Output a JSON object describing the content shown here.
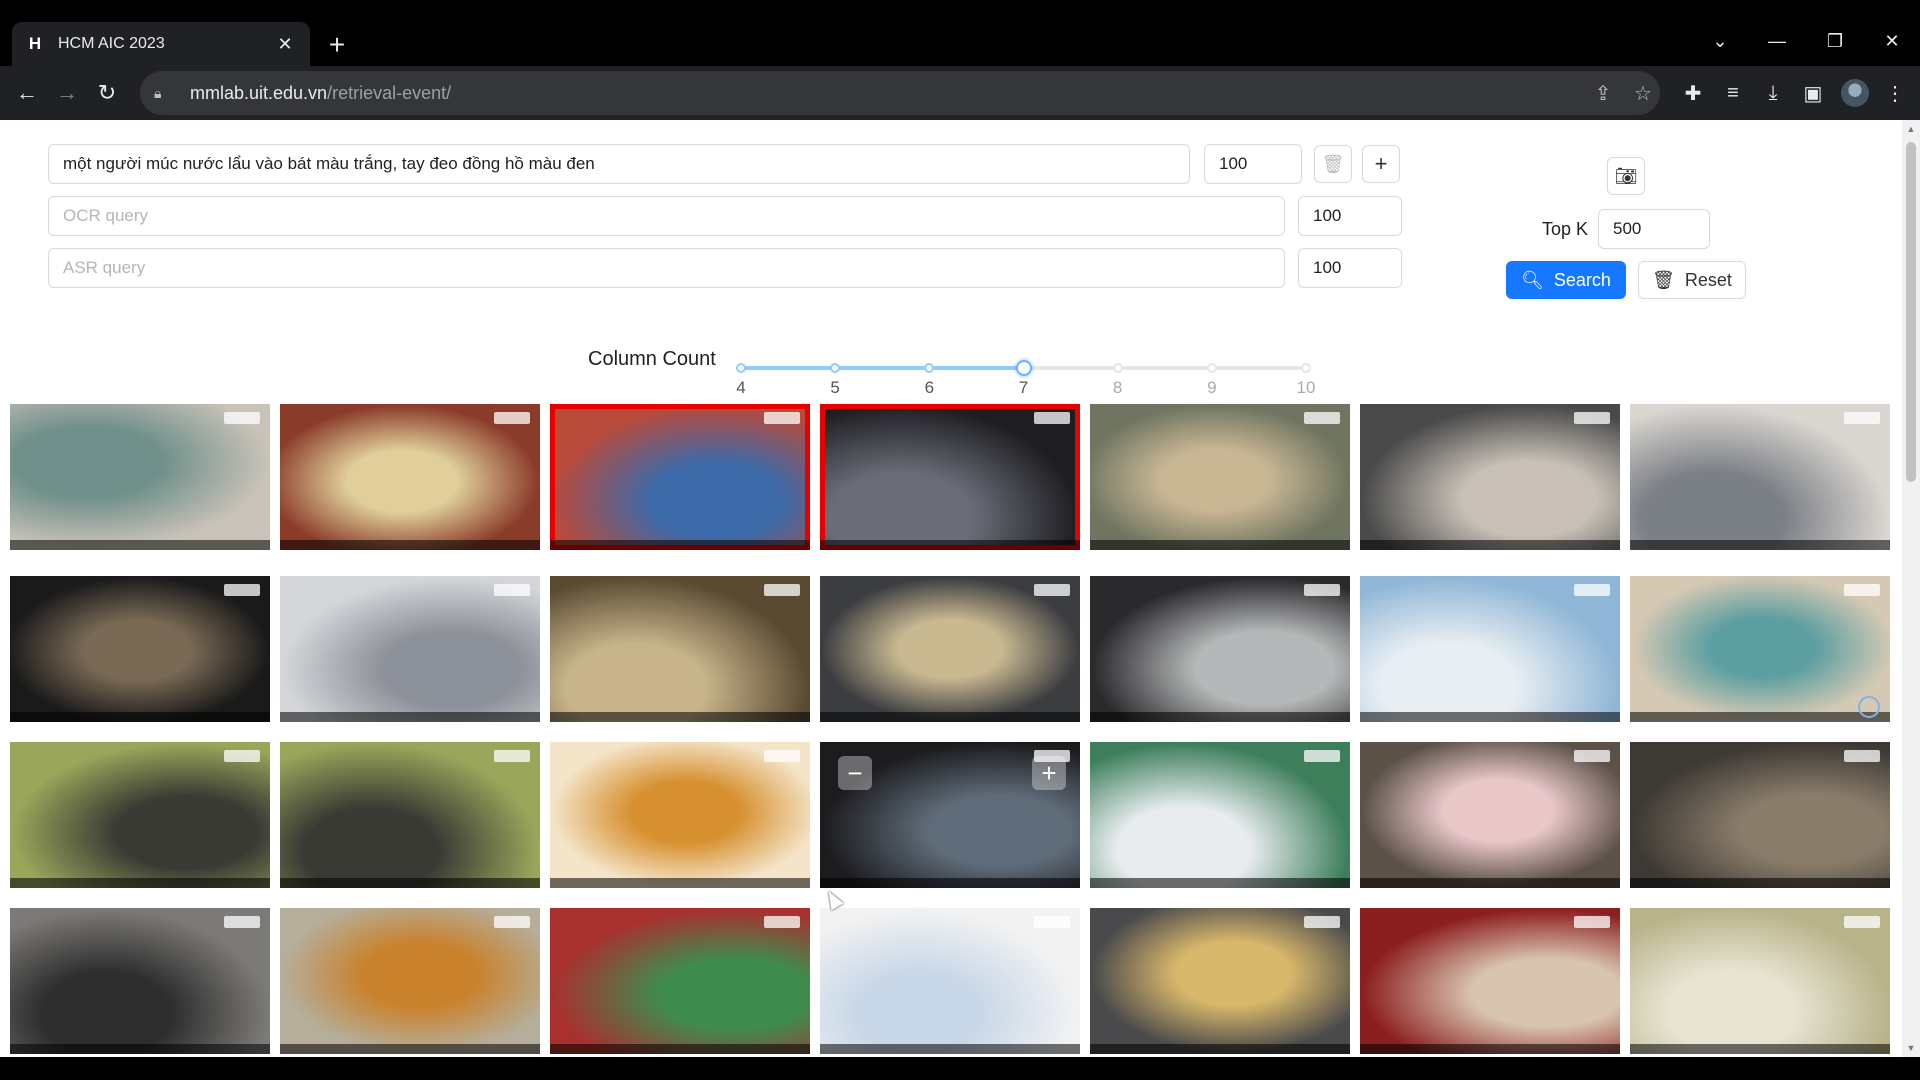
{
  "browser": {
    "tab_title": "HCM AIC 2023",
    "tab_close": "✕",
    "new_tab": "+",
    "url_host": "mmlab.uit.edu.vn",
    "url_path": "/retrieval-event/"
  },
  "query": {
    "text_value": "một người múc nước lẩu vào bát màu trắng, tay đeo đồng hồ màu đen",
    "text_weight": "100",
    "ocr_placeholder": "OCR query",
    "ocr_weight": "100",
    "asr_placeholder": "ASR query",
    "asr_weight": "100",
    "topk_label": "Top K",
    "topk_value": "500",
    "search_label": "Search",
    "reset_label": "Reset"
  },
  "slider": {
    "label": "Column Count",
    "marks": [
      "4",
      "5",
      "6",
      "7",
      "8",
      "9",
      "10"
    ],
    "min": 4,
    "max": 10,
    "value": 7
  },
  "gallery": {
    "columns": 7,
    "rows": 4,
    "selected": [
      3,
      4
    ],
    "notification_count": "2"
  },
  "colors": {
    "primary": "#1677ff",
    "selected_border": "#e60000",
    "slider_fill": "#91caff"
  }
}
